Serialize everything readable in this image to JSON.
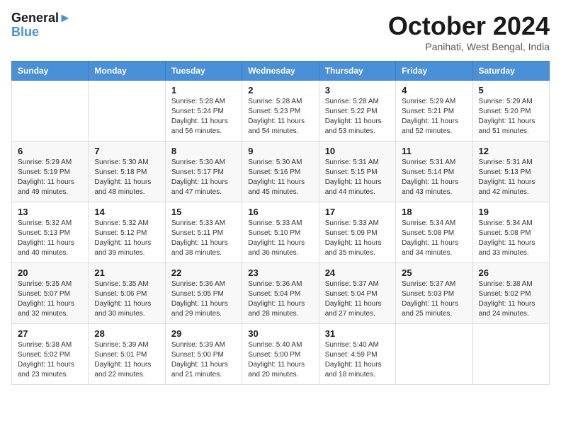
{
  "header": {
    "logo_line1": "General",
    "logo_line2": "Blue",
    "month_title": "October 2024",
    "subtitle": "Panihati, West Bengal, India"
  },
  "columns": [
    "Sunday",
    "Monday",
    "Tuesday",
    "Wednesday",
    "Thursday",
    "Friday",
    "Saturday"
  ],
  "weeks": [
    [
      {
        "day": "",
        "sunrise": "",
        "sunset": "",
        "daylight": ""
      },
      {
        "day": "",
        "sunrise": "",
        "sunset": "",
        "daylight": ""
      },
      {
        "day": "1",
        "sunrise": "Sunrise: 5:28 AM",
        "sunset": "Sunset: 5:24 PM",
        "daylight": "Daylight: 11 hours and 56 minutes."
      },
      {
        "day": "2",
        "sunrise": "Sunrise: 5:28 AM",
        "sunset": "Sunset: 5:23 PM",
        "daylight": "Daylight: 11 hours and 54 minutes."
      },
      {
        "day": "3",
        "sunrise": "Sunrise: 5:28 AM",
        "sunset": "Sunset: 5:22 PM",
        "daylight": "Daylight: 11 hours and 53 minutes."
      },
      {
        "day": "4",
        "sunrise": "Sunrise: 5:29 AM",
        "sunset": "Sunset: 5:21 PM",
        "daylight": "Daylight: 11 hours and 52 minutes."
      },
      {
        "day": "5",
        "sunrise": "Sunrise: 5:29 AM",
        "sunset": "Sunset: 5:20 PM",
        "daylight": "Daylight: 11 hours and 51 minutes."
      }
    ],
    [
      {
        "day": "6",
        "sunrise": "Sunrise: 5:29 AM",
        "sunset": "Sunset: 5:19 PM",
        "daylight": "Daylight: 11 hours and 49 minutes."
      },
      {
        "day": "7",
        "sunrise": "Sunrise: 5:30 AM",
        "sunset": "Sunset: 5:18 PM",
        "daylight": "Daylight: 11 hours and 48 minutes."
      },
      {
        "day": "8",
        "sunrise": "Sunrise: 5:30 AM",
        "sunset": "Sunset: 5:17 PM",
        "daylight": "Daylight: 11 hours and 47 minutes."
      },
      {
        "day": "9",
        "sunrise": "Sunrise: 5:30 AM",
        "sunset": "Sunset: 5:16 PM",
        "daylight": "Daylight: 11 hours and 45 minutes."
      },
      {
        "day": "10",
        "sunrise": "Sunrise: 5:31 AM",
        "sunset": "Sunset: 5:15 PM",
        "daylight": "Daylight: 11 hours and 44 minutes."
      },
      {
        "day": "11",
        "sunrise": "Sunrise: 5:31 AM",
        "sunset": "Sunset: 5:14 PM",
        "daylight": "Daylight: 11 hours and 43 minutes."
      },
      {
        "day": "12",
        "sunrise": "Sunrise: 5:31 AM",
        "sunset": "Sunset: 5:13 PM",
        "daylight": "Daylight: 11 hours and 42 minutes."
      }
    ],
    [
      {
        "day": "13",
        "sunrise": "Sunrise: 5:32 AM",
        "sunset": "Sunset: 5:13 PM",
        "daylight": "Daylight: 11 hours and 40 minutes."
      },
      {
        "day": "14",
        "sunrise": "Sunrise: 5:32 AM",
        "sunset": "Sunset: 5:12 PM",
        "daylight": "Daylight: 11 hours and 39 minutes."
      },
      {
        "day": "15",
        "sunrise": "Sunrise: 5:33 AM",
        "sunset": "Sunset: 5:11 PM",
        "daylight": "Daylight: 11 hours and 38 minutes."
      },
      {
        "day": "16",
        "sunrise": "Sunrise: 5:33 AM",
        "sunset": "Sunset: 5:10 PM",
        "daylight": "Daylight: 11 hours and 36 minutes."
      },
      {
        "day": "17",
        "sunrise": "Sunrise: 5:33 AM",
        "sunset": "Sunset: 5:09 PM",
        "daylight": "Daylight: 11 hours and 35 minutes."
      },
      {
        "day": "18",
        "sunrise": "Sunrise: 5:34 AM",
        "sunset": "Sunset: 5:08 PM",
        "daylight": "Daylight: 11 hours and 34 minutes."
      },
      {
        "day": "19",
        "sunrise": "Sunrise: 5:34 AM",
        "sunset": "Sunset: 5:08 PM",
        "daylight": "Daylight: 11 hours and 33 minutes."
      }
    ],
    [
      {
        "day": "20",
        "sunrise": "Sunrise: 5:35 AM",
        "sunset": "Sunset: 5:07 PM",
        "daylight": "Daylight: 11 hours and 32 minutes."
      },
      {
        "day": "21",
        "sunrise": "Sunrise: 5:35 AM",
        "sunset": "Sunset: 5:06 PM",
        "daylight": "Daylight: 11 hours and 30 minutes."
      },
      {
        "day": "22",
        "sunrise": "Sunrise: 5:36 AM",
        "sunset": "Sunset: 5:05 PM",
        "daylight": "Daylight: 11 hours and 29 minutes."
      },
      {
        "day": "23",
        "sunrise": "Sunrise: 5:36 AM",
        "sunset": "Sunset: 5:04 PM",
        "daylight": "Daylight: 11 hours and 28 minutes."
      },
      {
        "day": "24",
        "sunrise": "Sunrise: 5:37 AM",
        "sunset": "Sunset: 5:04 PM",
        "daylight": "Daylight: 11 hours and 27 minutes."
      },
      {
        "day": "25",
        "sunrise": "Sunrise: 5:37 AM",
        "sunset": "Sunset: 5:03 PM",
        "daylight": "Daylight: 11 hours and 25 minutes."
      },
      {
        "day": "26",
        "sunrise": "Sunrise: 5:38 AM",
        "sunset": "Sunset: 5:02 PM",
        "daylight": "Daylight: 11 hours and 24 minutes."
      }
    ],
    [
      {
        "day": "27",
        "sunrise": "Sunrise: 5:38 AM",
        "sunset": "Sunset: 5:02 PM",
        "daylight": "Daylight: 11 hours and 23 minutes."
      },
      {
        "day": "28",
        "sunrise": "Sunrise: 5:39 AM",
        "sunset": "Sunset: 5:01 PM",
        "daylight": "Daylight: 11 hours and 22 minutes."
      },
      {
        "day": "29",
        "sunrise": "Sunrise: 5:39 AM",
        "sunset": "Sunset: 5:00 PM",
        "daylight": "Daylight: 11 hours and 21 minutes."
      },
      {
        "day": "30",
        "sunrise": "Sunrise: 5:40 AM",
        "sunset": "Sunset: 5:00 PM",
        "daylight": "Daylight: 11 hours and 20 minutes."
      },
      {
        "day": "31",
        "sunrise": "Sunrise: 5:40 AM",
        "sunset": "Sunset: 4:59 PM",
        "daylight": "Daylight: 11 hours and 18 minutes."
      },
      {
        "day": "",
        "sunrise": "",
        "sunset": "",
        "daylight": ""
      },
      {
        "day": "",
        "sunrise": "",
        "sunset": "",
        "daylight": ""
      }
    ]
  ]
}
